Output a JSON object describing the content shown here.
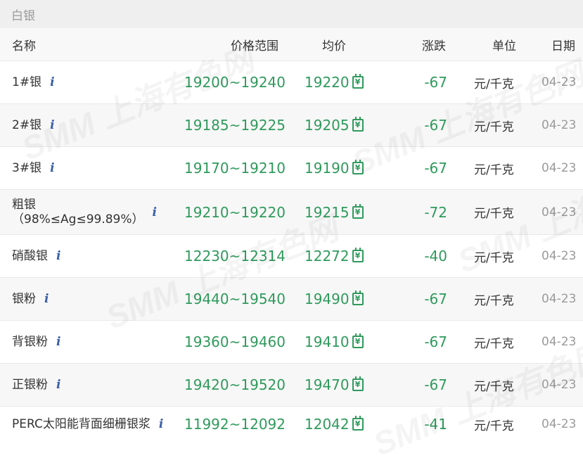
{
  "section_title": "白银",
  "columns": {
    "name": "名称",
    "range": "价格范围",
    "avg": "均价",
    "change": "涨跌",
    "unit": "单位",
    "date": "日期"
  },
  "watermark_text": "SMM 上海有色网",
  "rows": [
    {
      "name": "1#银",
      "range": "19200~19240",
      "avg": "19220",
      "change": "-67",
      "unit": "元/千克",
      "date": "04-23"
    },
    {
      "name": "2#银",
      "range": "19185~19225",
      "avg": "19205",
      "change": "-67",
      "unit": "元/千克",
      "date": "04-23"
    },
    {
      "name": "3#银",
      "range": "19170~19210",
      "avg": "19190",
      "change": "-67",
      "unit": "元/千克",
      "date": "04-23"
    },
    {
      "name": "粗银\n（98%≤Ag≤99.89%）",
      "range": "19210~19220",
      "avg": "19215",
      "change": "-72",
      "unit": "元/千克",
      "date": "04-23"
    },
    {
      "name": "硝酸银",
      "range": "12230~12314",
      "avg": "12272",
      "change": "-40",
      "unit": "元/千克",
      "date": "04-23"
    },
    {
      "name": "银粉",
      "range": "19440~19540",
      "avg": "19490",
      "change": "-67",
      "unit": "元/千克",
      "date": "04-23"
    },
    {
      "name": "背银粉",
      "range": "19360~19460",
      "avg": "19410",
      "change": "-67",
      "unit": "元/千克",
      "date": "04-23"
    },
    {
      "name": "正银粉",
      "range": "19420~19520",
      "avg": "19470",
      "change": "-67",
      "unit": "元/千克",
      "date": "04-23"
    },
    {
      "name": "PERC太阳能背面细栅银浆",
      "range": "11992~12092",
      "avg": "12042",
      "change": "-41",
      "unit": "元/千克",
      "date": "04-23"
    }
  ],
  "icons": {
    "info": "i",
    "calendar": "¥"
  },
  "colors": {
    "price_green": "#2f9a5c",
    "info_blue": "#3a5fa8",
    "header_bg": "#efefef"
  }
}
